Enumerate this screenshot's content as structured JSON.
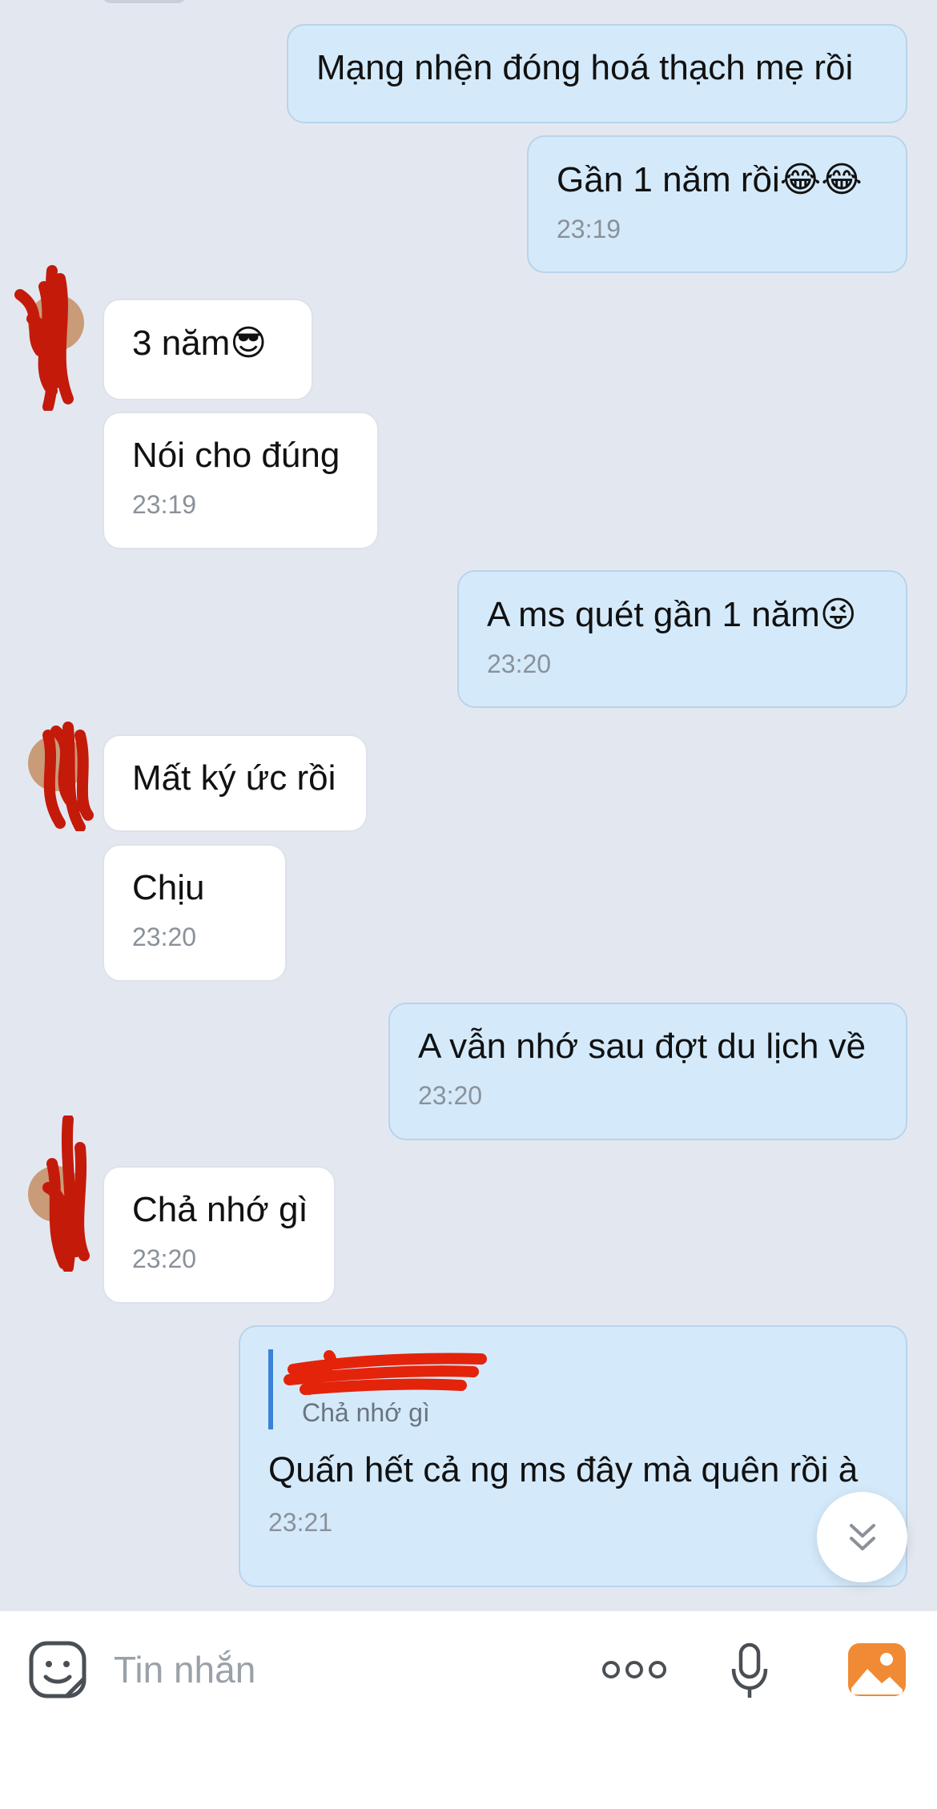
{
  "messages": [
    {
      "dir": "out",
      "text": "Mạng nhện đóng hoá thạch mẹ rồi",
      "time": ""
    },
    {
      "dir": "out",
      "text": "Gần 1 năm rồi😂😂",
      "time": "23:19"
    },
    {
      "dir": "in",
      "text": "3 năm😎",
      "time": ""
    },
    {
      "dir": "in",
      "text": "Nói cho đúng",
      "time": "23:19"
    },
    {
      "dir": "out",
      "text": "A ms quét gần 1 năm😜",
      "time": "23:20"
    },
    {
      "dir": "in",
      "text": "Mất ký ức rồi",
      "time": ""
    },
    {
      "dir": "in",
      "text": "Chịu",
      "time": "23:20"
    },
    {
      "dir": "out",
      "text": "A vẫn nhớ sau đợt du lịch về",
      "time": "23:20"
    },
    {
      "dir": "in",
      "text": "Chả nhớ gì",
      "time": "23:20"
    },
    {
      "dir": "out",
      "reply_to": "Chả nhớ gì",
      "text": "Quấn hết cả ng ms đây mà quên rồi à",
      "time": "23:21"
    }
  ],
  "composer": {
    "placeholder": "Tin nhắn",
    "icons": [
      "sticker-icon",
      "more-icon",
      "microphone-icon",
      "image-icon"
    ]
  },
  "scroll_button_icon": "chevron-double-down-icon",
  "colors": {
    "background": "#e3e8f0",
    "outgoing_bubble": "#d4eafb",
    "incoming_bubble": "#ffffff",
    "reply_bar": "#3b82d6",
    "redaction": "#c41a0a",
    "image_icon": "#f08a34"
  }
}
